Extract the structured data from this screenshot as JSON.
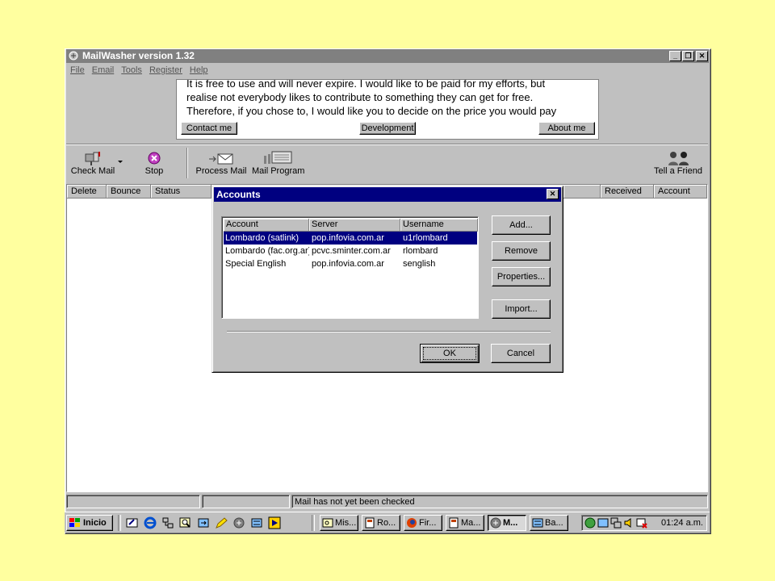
{
  "window": {
    "title": "MailWasher version 1.32",
    "controls": {
      "minimize": "_",
      "restore": "❐",
      "close": "✕"
    }
  },
  "menu": [
    "File",
    "Email",
    "Tools",
    "Register",
    "Help"
  ],
  "banner": {
    "lines": [
      "It is free to use and will never expire. I would like to be paid for my efforts, but",
      "realise not everybody likes to contribute to something they can get for free.",
      "Therefore, if you chose to, I would like you to decide on the price you would pay"
    ],
    "buttons": {
      "contact": "Contact me",
      "development": "Development",
      "about": "About me"
    }
  },
  "toolbar": {
    "check_mail": "Check Mail",
    "stop": "Stop",
    "process_mail": "Process Mail",
    "mail_program": "Mail Program",
    "tell_friend": "Tell a Friend"
  },
  "columns": {
    "delete": "Delete",
    "bounce": "Bounce",
    "status": "Status",
    "received": "Received",
    "account": "Account"
  },
  "dialog": {
    "title": "Accounts",
    "close": "✕",
    "list_headers": {
      "account": "Account",
      "server": "Server",
      "username": "Username"
    },
    "rows": [
      {
        "account": "Lombardo (satlink)",
        "server": "pop.infovia.com.ar",
        "username": "u1rlombard",
        "selected": true
      },
      {
        "account": "Lombardo (fac.org.ar)",
        "server": "pcvc.sminter.com.ar",
        "username": "rlombard",
        "selected": false
      },
      {
        "account": "Special English",
        "server": "pop.infovia.com.ar",
        "username": "senglish",
        "selected": false
      }
    ],
    "buttons": {
      "add": "Add...",
      "remove": "Remove",
      "properties": "Properties...",
      "import": "Import...",
      "ok": "OK",
      "cancel": "Cancel"
    }
  },
  "status_bar": {
    "message": "Mail has not yet been checked"
  },
  "taskbar": {
    "start": "Inicio",
    "tasks": [
      "Mis...",
      "Ro...",
      "Fir...",
      "Ma...",
      "M...",
      "Ba..."
    ],
    "active_task": "M...",
    "clock": "01:24 a.m."
  },
  "colors": {
    "desktop": "#ffff9f",
    "face": "#c0c0c0",
    "active_title": "#000080",
    "inactive_title": "#808080",
    "selection": "#000080"
  }
}
